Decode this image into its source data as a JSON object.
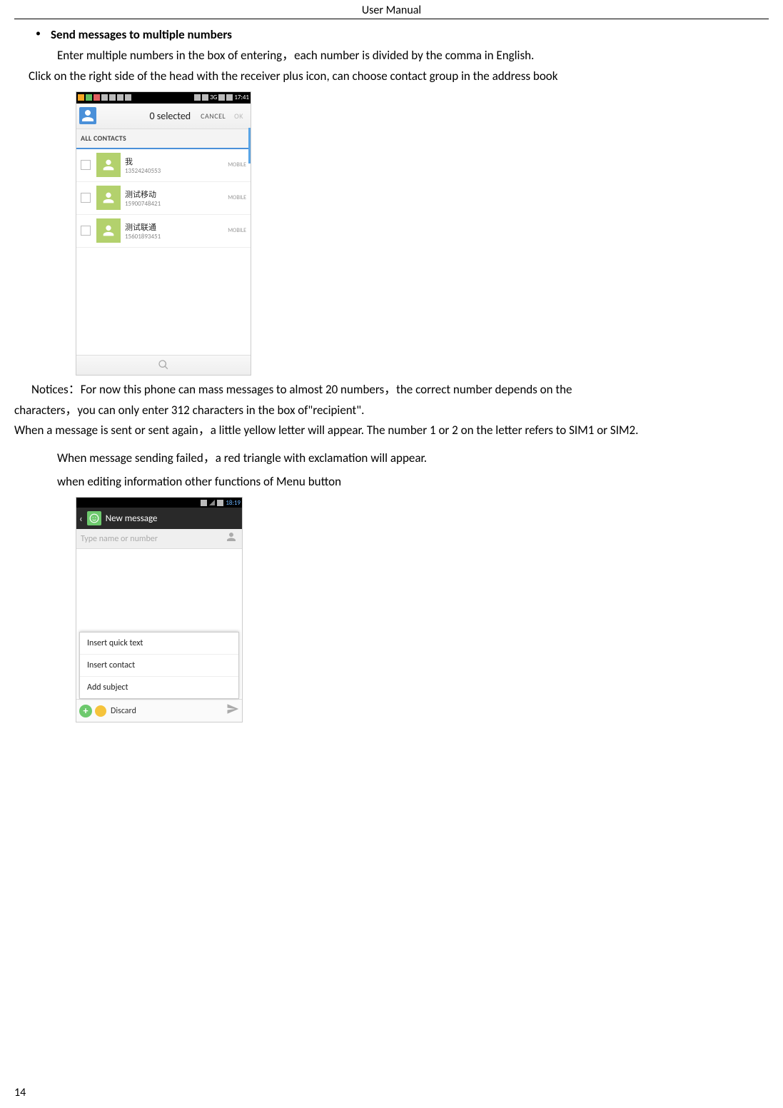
{
  "header": {
    "title": "User    Manual"
  },
  "sections": {
    "bulletTitle": "Send messages to multiple numbers",
    "line1": "Enter multiple numbers in the box of entering，each number is divided by the comma in English.",
    "line2": "Click on the right side of the head with the receiver plus icon, can choose contact group in the address book",
    "noticesLabel": "Notices：",
    "notices1": "For now this phone can mass messages to almost 20 numbers，the correct number depends on the",
    "notices2": "characters，you can only enter 312 characters in the box of\"recipient\".",
    "simLine": "When a message is sent or sent again，a little yellow letter will appear. The number 1 or 2 on the letter refers to SIM1 or SIM2.",
    "failLine": "When message sending failed，a red triangle with exclamation will appear.",
    "menuLine": "when editing information other functions of Menu button"
  },
  "screenshot1": {
    "statusTime": "17:41",
    "statusNet": "3G",
    "selected": "0 selected",
    "cancel": "CANCEL",
    "ok": "OK",
    "tab": "ALL CONTACTS",
    "contacts": [
      {
        "name": "我",
        "number": "13524240553",
        "type": "MOBILE"
      },
      {
        "name": "测试移动",
        "number": "15900748421",
        "type": "MOBILE"
      },
      {
        "name": "测试联通",
        "number": "15601893451",
        "type": "MOBILE"
      }
    ]
  },
  "screenshot2": {
    "statusTime": "18:19",
    "title": "New message",
    "placeholder": "Type name or number",
    "menu": {
      "item1": "Insert quick text",
      "item2": "Insert contact",
      "item3": "Add subject"
    },
    "compose": "Discard"
  },
  "pageNumber": "14"
}
